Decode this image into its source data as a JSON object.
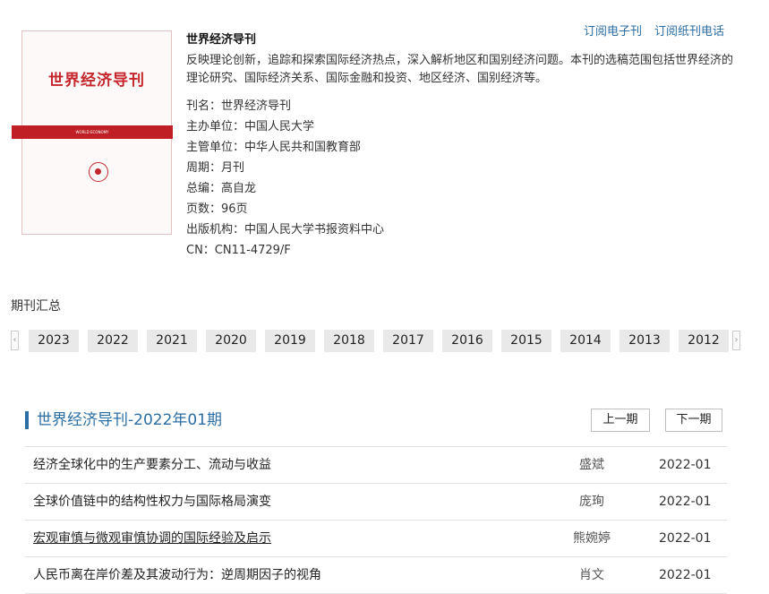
{
  "cover": {
    "top_text": "",
    "title": "世界经济导刊",
    "band_text": "WORLD ECONOMY"
  },
  "subscribe": {
    "electronic": "订阅电子刊",
    "paper_phone": "订阅纸刊电话"
  },
  "journal": {
    "name": "世界经济导刊",
    "description": "反映理论创新，追踪和探索国际经济热点，深入解析地区和国别经济问题。本刊的选稿范围包括世界经济的理论研究、国际经济关系、国际金融和投资、地区经济、国别经济等。",
    "meta": [
      "刊名：世界经济导刊",
      "主办单位：中国人民大学",
      "主管单位：中华人民共和国教育部",
      "周期：月刊",
      "总编：高自龙",
      "页数：96页",
      "出版机构：中国人民大学书报资料中心",
      "CN：CN11-4729/F"
    ]
  },
  "archive": {
    "title": "期刊汇总",
    "prev_icon": "‹",
    "next_icon": "›",
    "years": [
      "2023",
      "2022",
      "2021",
      "2020",
      "2019",
      "2018",
      "2017",
      "2016",
      "2015",
      "2014",
      "2013",
      "2012"
    ]
  },
  "issue": {
    "title": "世界经济导刊-2022年01期",
    "prev_label": "上一期",
    "next_label": "下一期",
    "articles": [
      {
        "title": "经济全球化中的生产要素分工、流动与收益",
        "author": "盛斌",
        "date": "2022-01"
      },
      {
        "title": "全球价值链中的结构性权力与国际格局演变",
        "author": "庞珣",
        "date": "2022-01"
      },
      {
        "title": "宏观审慎与微观审慎协调的国际经验及启示",
        "author": "熊婉婷",
        "date": "2022-01"
      },
      {
        "title": "人民币离在岸价差及其波动行为：逆周期因子的视角",
        "author": "肖文",
        "date": "2022-01"
      }
    ]
  },
  "colors": {
    "accent": "#2b6ea5",
    "cover_red": "#c4262b"
  }
}
